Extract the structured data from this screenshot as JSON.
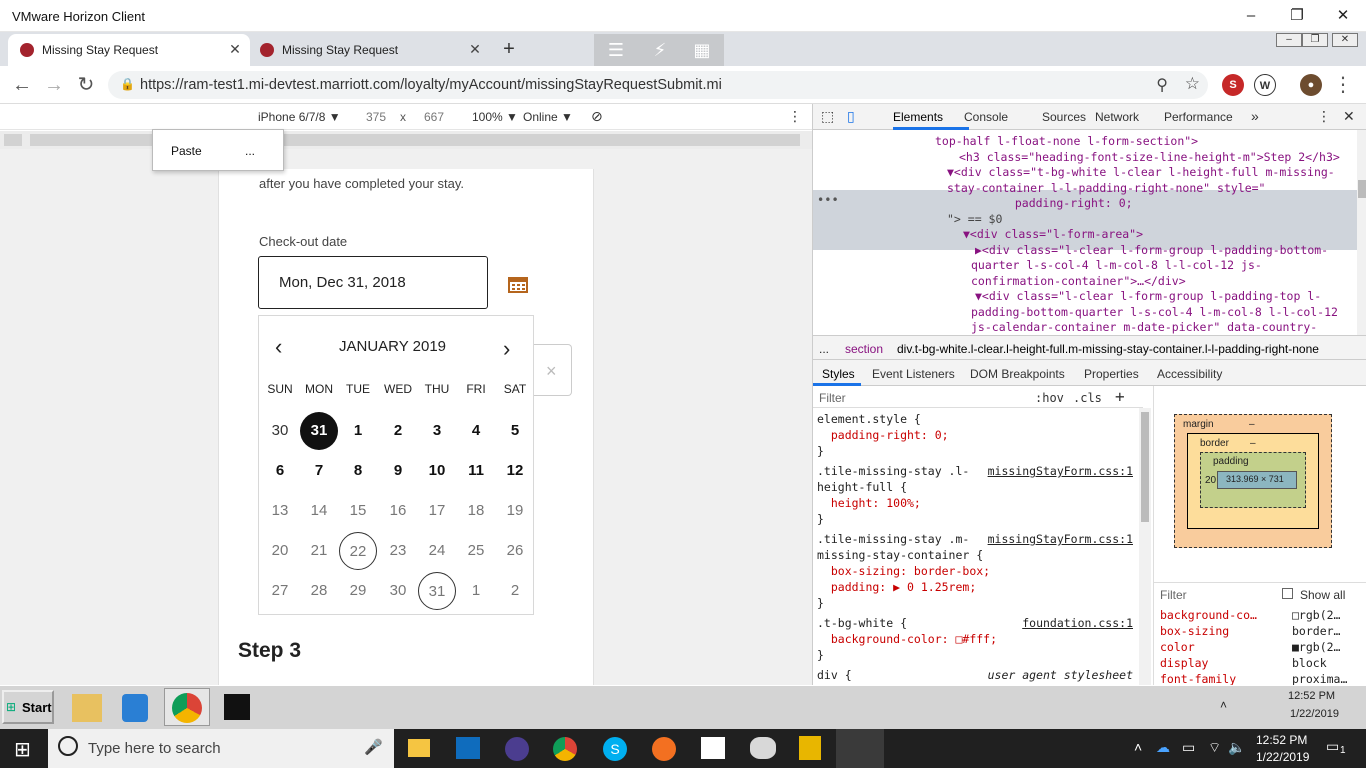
{
  "window": {
    "title": "VMware Horizon Client"
  },
  "tabs": [
    {
      "label": "Missing Stay Request",
      "active": true
    },
    {
      "label": "Missing Stay Request",
      "active": false
    }
  ],
  "address": {
    "url": "https://ram-test1.mi-devtest.marriott.com/loyalty/myAccount/missingStayRequestSubmit.mi"
  },
  "device_toolbar": {
    "device": "iPhone 6/7/8 ▼",
    "width": "375",
    "x": "x",
    "height": "667",
    "zoom": "100% ▼",
    "network": "Online ▼"
  },
  "context_menu": {
    "paste": "Paste",
    "more": "..."
  },
  "page": {
    "intro_text": "after you have completed your stay.",
    "checkout_label": "Check-out date",
    "checkout_value": "Mon, Dec 31, 2018",
    "calendar": {
      "month": "JANUARY 2019",
      "prev": "‹",
      "next": "›",
      "weekdays": [
        "SUN",
        "MON",
        "TUE",
        "WED",
        "THU",
        "FRI",
        "SAT"
      ],
      "weeks": [
        [
          {
            "d": "30",
            "s": "muted"
          },
          {
            "d": "31",
            "s": "selected"
          },
          {
            "d": "1",
            "s": "bold"
          },
          {
            "d": "2",
            "s": "bold"
          },
          {
            "d": "3",
            "s": "bold"
          },
          {
            "d": "4",
            "s": "bold"
          },
          {
            "d": "5",
            "s": "bold"
          }
        ],
        [
          {
            "d": "6",
            "s": "bold"
          },
          {
            "d": "7",
            "s": "bold"
          },
          {
            "d": "8",
            "s": "bold"
          },
          {
            "d": "9",
            "s": "bold"
          },
          {
            "d": "10",
            "s": "bold"
          },
          {
            "d": "11",
            "s": "bold"
          },
          {
            "d": "12",
            "s": "bold"
          }
        ],
        [
          {
            "d": "13",
            "s": "light"
          },
          {
            "d": "14",
            "s": "light"
          },
          {
            "d": "15",
            "s": "light"
          },
          {
            "d": "16",
            "s": "light"
          },
          {
            "d": "17",
            "s": "light"
          },
          {
            "d": "18",
            "s": "light"
          },
          {
            "d": "19",
            "s": "light"
          }
        ],
        [
          {
            "d": "20",
            "s": "light"
          },
          {
            "d": "21",
            "s": "light"
          },
          {
            "d": "22",
            "s": "ring"
          },
          {
            "d": "23",
            "s": "light"
          },
          {
            "d": "24",
            "s": "light"
          },
          {
            "d": "25",
            "s": "light"
          },
          {
            "d": "26",
            "s": "light"
          }
        ],
        [
          {
            "d": "27",
            "s": "light"
          },
          {
            "d": "28",
            "s": "light"
          },
          {
            "d": "29",
            "s": "light"
          },
          {
            "d": "30",
            "s": "light"
          },
          {
            "d": "31",
            "s": "ring"
          },
          {
            "d": "1",
            "s": "light"
          },
          {
            "d": "2",
            "s": "light"
          }
        ]
      ]
    },
    "clear_icon": "×",
    "step3": "Step 3"
  },
  "devtools": {
    "tabs": [
      "Elements",
      "Console",
      "Sources",
      "Network",
      "Performance",
      "»"
    ],
    "elements": [
      {
        "text": "top-half l-float-none l-form-section\">"
      },
      {
        "text": "<h3 class=\"heading-font-size-line-height-m\">Step 2</h3>"
      },
      {
        "text": "▼<div class=\"t-bg-white l-clear l-height-full m-missing-"
      },
      {
        "text": "stay-container l-l-padding-right-none\" style=\""
      },
      {
        "text": "  padding-right: 0;"
      },
      {
        "text": "\"> == $0"
      },
      {
        "text": "▼<div class=\"l-form-area\">"
      },
      {
        "text": "▶<div class=\"l-clear l-form-group l-padding-bottom-"
      },
      {
        "text": "quarter l-s-col-4 l-m-col-8 l-l-col-12 js-"
      },
      {
        "text": "confirmation-container\">…</div>"
      },
      {
        "text": "▼<div class=\"l-clear l-form-group l-padding-top l-"
      },
      {
        "text": "padding-bottom-quarter l-s-col-4 l-m-col-8 l-l-col-12"
      },
      {
        "text": "js-calendar-container m-date-picker\" data-country-"
      }
    ],
    "breadcrumb": {
      "more": "...",
      "item1": "section",
      "item2": "div.t-bg-white.l-clear.l-height-full.m-missing-stay-container.l-l-padding-right-none"
    },
    "subtabs": [
      "Styles",
      "Event Listeners",
      "DOM Breakpoints",
      "Properties",
      "Accessibility"
    ],
    "filter_placeholder": "Filter",
    "hov": ":hov",
    "cls": ".cls",
    "plus": "+",
    "styles": [
      {
        "t": "element.style {",
        "c": "sel"
      },
      {
        "t": "  padding-right: 0;",
        "c": "prop"
      },
      {
        "t": "}",
        "c": "sel"
      },
      {
        "t": ".tile-missing-stay .l-",
        "c": "sel",
        "src": "missingStayForm.css:1"
      },
      {
        "t": "height-full {",
        "c": "sel"
      },
      {
        "t": "  height: 100%;",
        "c": "prop"
      },
      {
        "t": "}",
        "c": "sel"
      },
      {
        "t": ".tile-missing-stay .m-",
        "c": "sel",
        "src": "missingStayForm.css:1"
      },
      {
        "t": "missing-stay-container {",
        "c": "sel"
      },
      {
        "t": "  box-sizing: border-box;",
        "c": "prop"
      },
      {
        "t": "  padding: ▶ 0 1.25rem;",
        "c": "prop"
      },
      {
        "t": "}",
        "c": "sel"
      },
      {
        "t": ".t-bg-white {",
        "c": "sel",
        "src": "foundation.css:1"
      },
      {
        "t": "  background-color: □#fff;",
        "c": "prop"
      },
      {
        "t": "}",
        "c": "sel"
      },
      {
        "t": "div {",
        "c": "sel",
        "src": "user agent stylesheet"
      },
      {
        "t": "  display: block;",
        "c": "prop"
      }
    ],
    "boxmodel": {
      "margin": "margin",
      "border": "border",
      "padding": "padding",
      "dash": "–",
      "left": "20",
      "content": "313.969 × 731"
    },
    "computed_filter": "Filter",
    "show_all": "Show all",
    "computed": [
      {
        "p": "background-co…",
        "v": "□rgb(2…"
      },
      {
        "p": "box-sizing",
        "v": "border…"
      },
      {
        "p": "color",
        "v": "■rgb(2…"
      },
      {
        "p": "display",
        "v": "block"
      },
      {
        "p": "font-family",
        "v": "proxima…"
      }
    ]
  },
  "vm_taskbar": {
    "start": "Start",
    "time": "12:52 PM",
    "date": "1/22/2019"
  },
  "win_taskbar": {
    "search": "Type here to search",
    "time": "12:52 PM",
    "date": "1/22/2019",
    "notif": "1"
  }
}
